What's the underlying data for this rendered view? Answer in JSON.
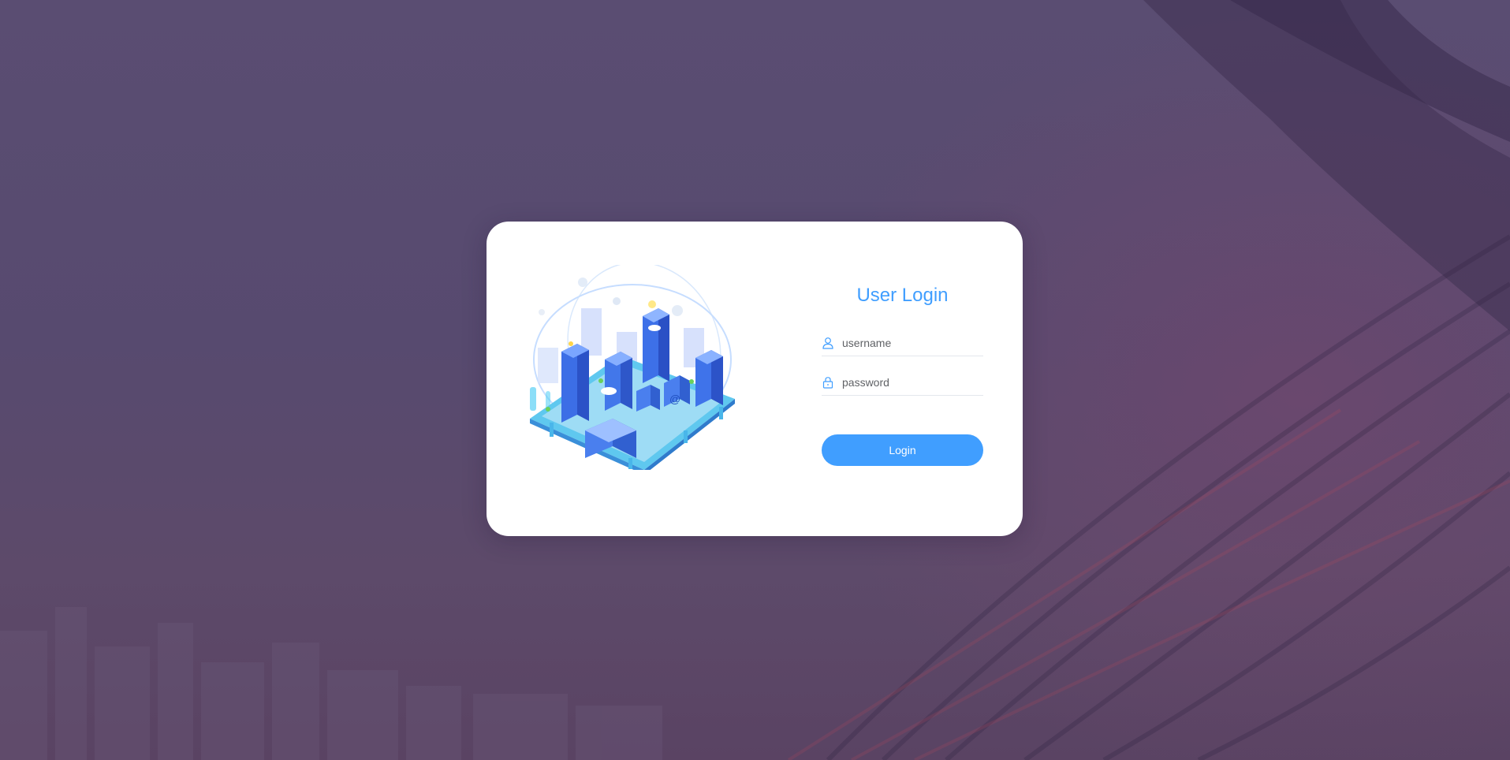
{
  "login": {
    "title": "User Login",
    "username_placeholder": "username",
    "password_placeholder": "password",
    "button_label": "Login"
  },
  "icons": {
    "username": "user-icon",
    "password": "lock-icon"
  },
  "colors": {
    "accent": "#409eff",
    "background": "#574a6f",
    "card": "#ffffff"
  }
}
